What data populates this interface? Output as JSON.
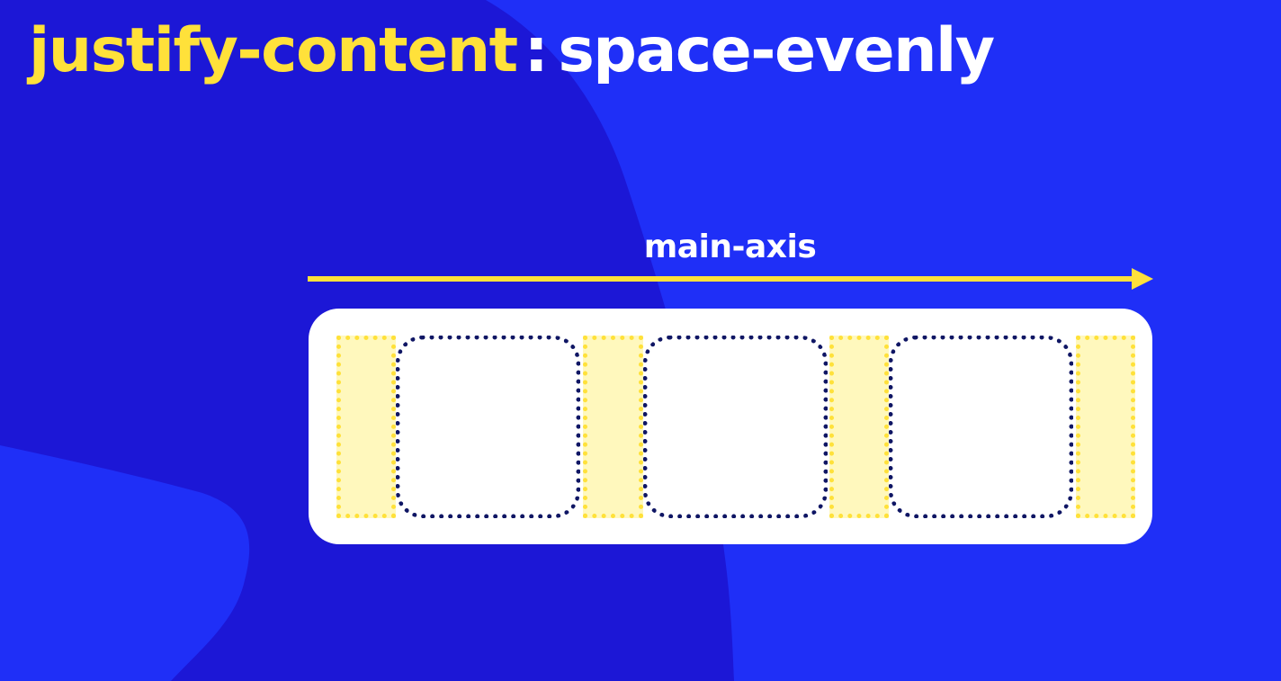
{
  "title": {
    "property": "justify-content",
    "separator": ":",
    "value": "space-evenly"
  },
  "axis": {
    "label": "main-axis"
  },
  "flex_container": {
    "item_count": 3,
    "space_count": 4
  },
  "colors": {
    "background": "#1f2ff7",
    "background_shape": "#1c17d6",
    "accent_yellow": "#ffe13a",
    "space_fill": "#fff8bd",
    "item_border": "#0f1664",
    "container": "#ffffff"
  }
}
